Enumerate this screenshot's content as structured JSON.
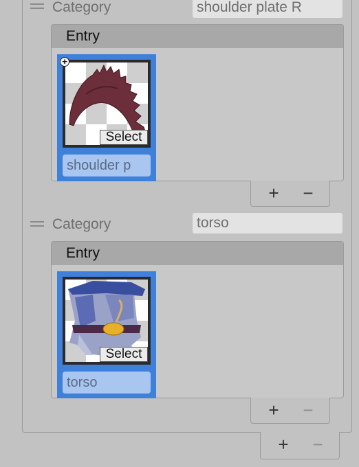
{
  "categories": [
    {
      "label": "Category",
      "value": "shoulder plate R",
      "entry_header": "Entry",
      "item": {
        "select_label": "Select",
        "name": "shoulder p",
        "icon": "plus-icon"
      },
      "footer": {
        "add": "+",
        "remove": "−"
      }
    },
    {
      "label": "Category",
      "value": "torso",
      "entry_header": "Entry",
      "item": {
        "select_label": "Select",
        "name": "torso"
      },
      "footer": {
        "add": "+",
        "remove": "−"
      }
    }
  ],
  "outer_footer": {
    "add": "+",
    "remove": "−"
  },
  "colors": {
    "selected_tile": "#3f80db",
    "name_field": "#a9c6f0"
  }
}
